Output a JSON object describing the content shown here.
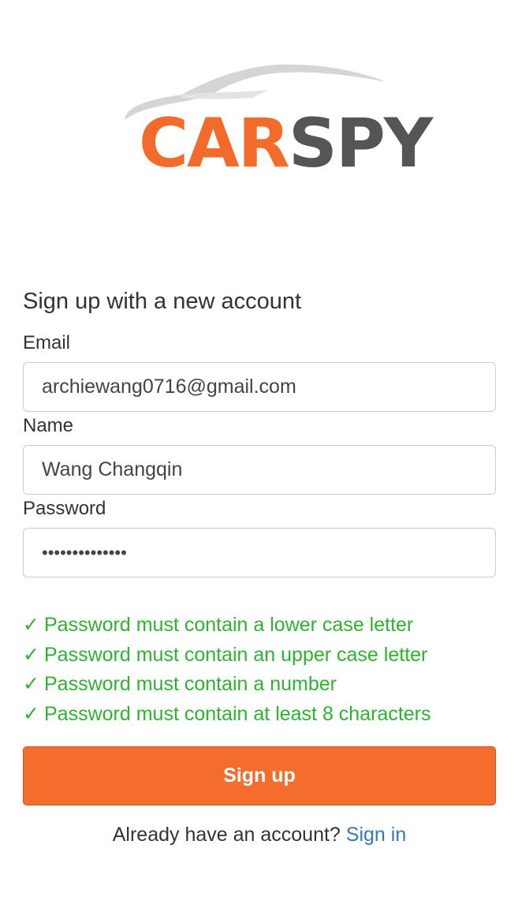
{
  "logo": {
    "text_part1": "CAR",
    "text_part2": "SPY",
    "color_orange": "#f36b2a",
    "color_gray": "#555555"
  },
  "form": {
    "heading": "Sign up with a new account",
    "email": {
      "label": "Email",
      "value": "archiewang0716@gmail.com"
    },
    "name": {
      "label": "Name",
      "value": "Wang Changqin"
    },
    "password": {
      "label": "Password",
      "masked_value": "••••••••••••••"
    },
    "rules": [
      {
        "check": "✓",
        "text": "Password must contain a lower case letter"
      },
      {
        "check": "✓",
        "text": "Password must contain an upper case letter"
      },
      {
        "check": "✓",
        "text": "Password must contain a number"
      },
      {
        "check": "✓",
        "text": "Password must contain at least 8 characters"
      }
    ],
    "submit_label": "Sign up",
    "footer_text": "Already have an account?",
    "signin_link": "Sign in"
  },
  "colors": {
    "accent": "#f56d2d",
    "rule_ok": "#2db32d",
    "link": "#337ab7"
  }
}
